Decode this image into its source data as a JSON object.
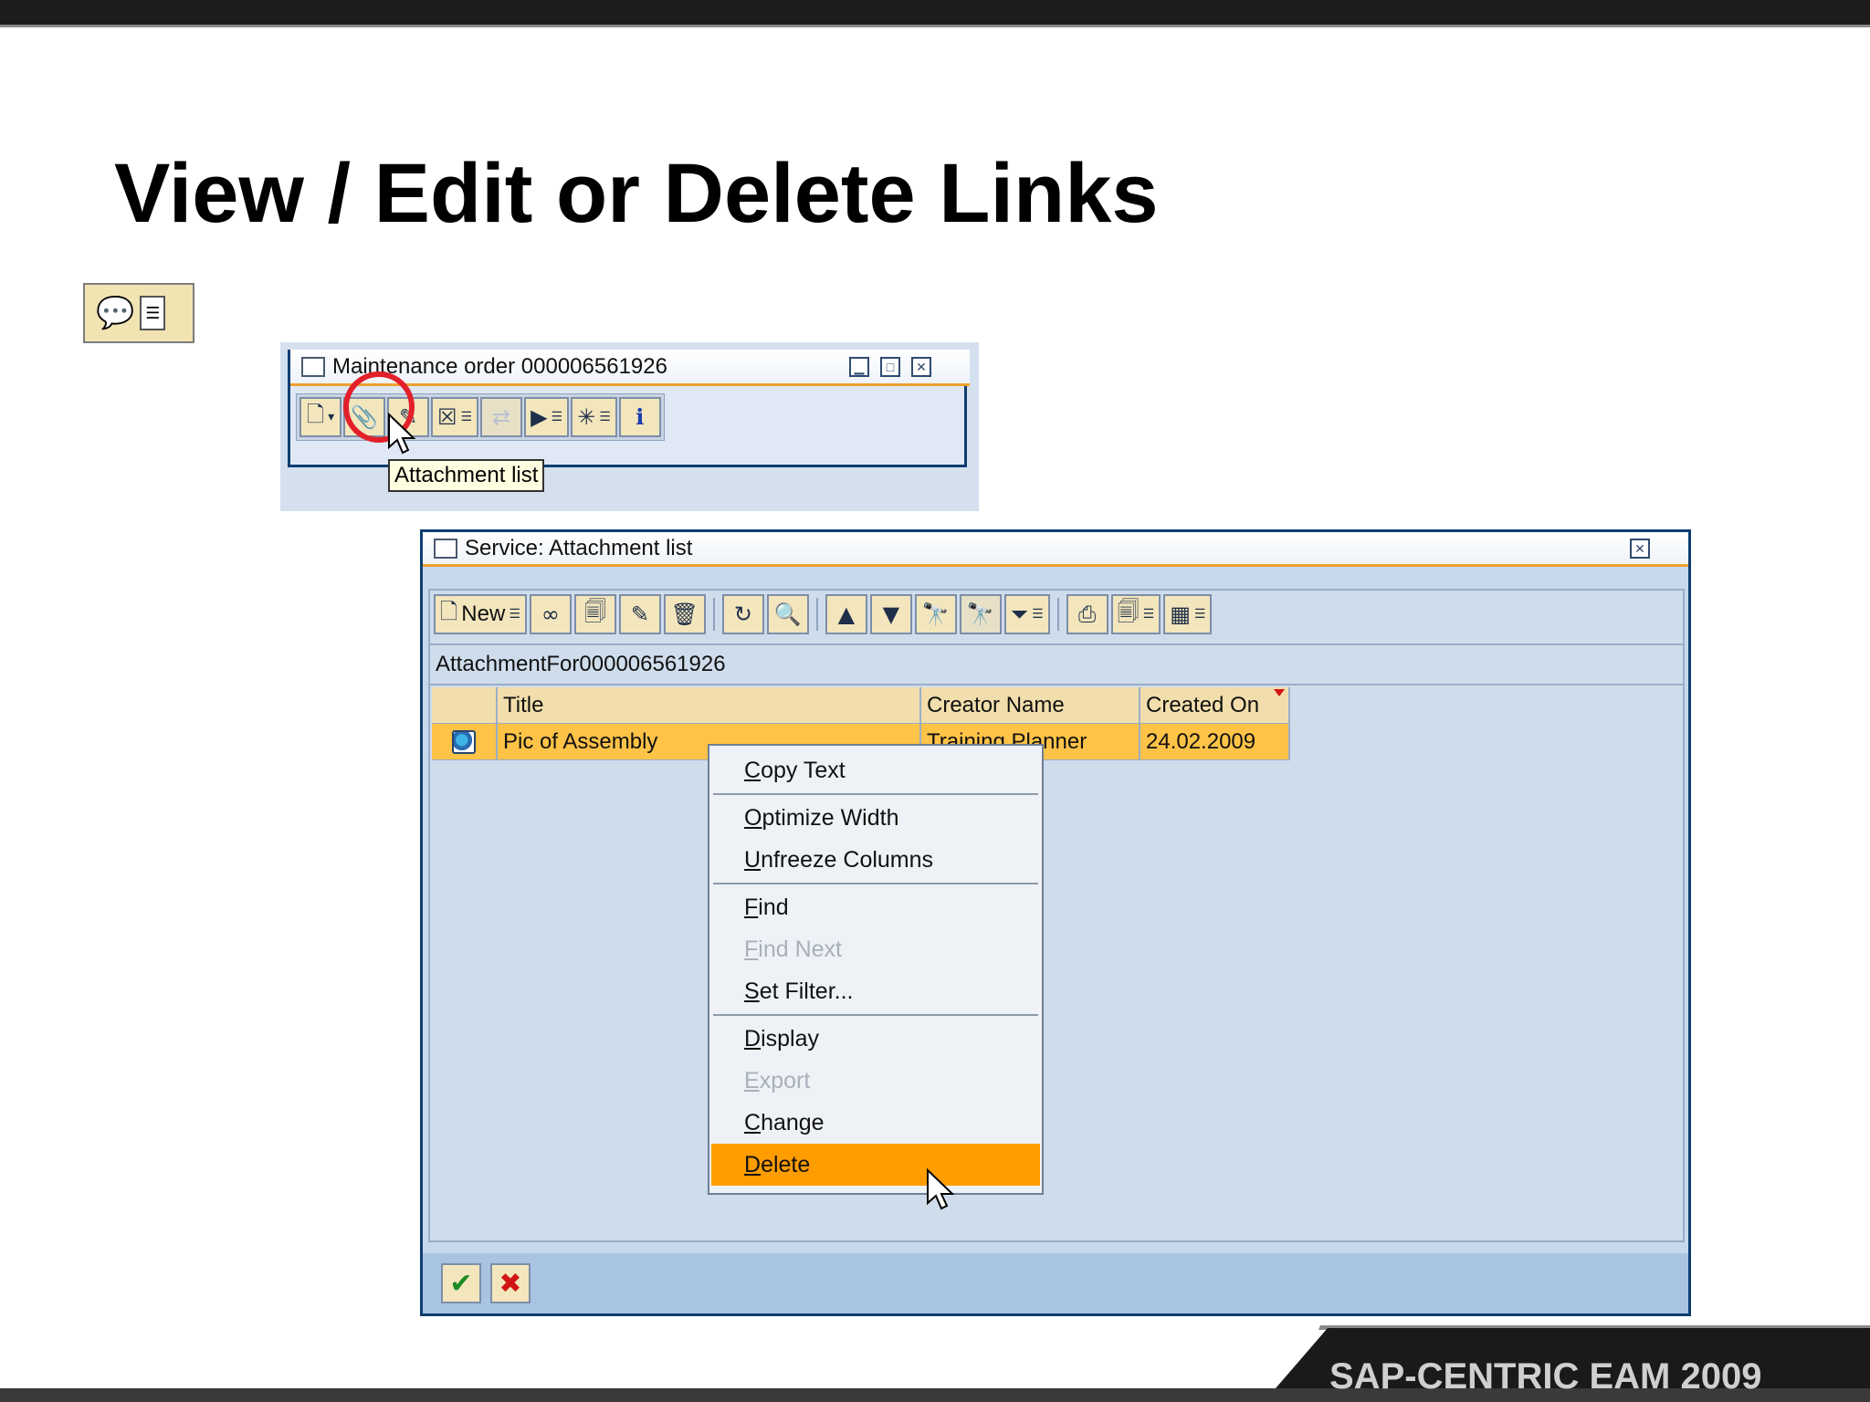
{
  "slide": {
    "title": "View / Edit or Delete Links",
    "brand": "SAP-CENTRIC EAM 2009"
  },
  "mini_window": {
    "title": "Maintenance order 000006561926",
    "tooltip": "Attachment list",
    "toolbar_icons": [
      "create-icon",
      "attachment-list-icon",
      "edit-pencil-icon",
      "export-icon",
      "relationship-icon",
      "send-icon",
      "workflow-icon",
      "info-icon"
    ]
  },
  "dialog": {
    "title": "Service: Attachment list",
    "toolbar": {
      "new_label": "New"
    },
    "caption": "AttachmentFor000006561926",
    "columns": [
      "Title",
      "Creator Name",
      "Created On"
    ],
    "rows": [
      {
        "title": "Pic of Assembly",
        "creator": "Training Planner",
        "created_on": "24.02.2009"
      }
    ]
  },
  "context_menu": {
    "items": [
      {
        "label": "Copy Text",
        "accel": "C",
        "rest": "opy Text",
        "enabled": true
      },
      {
        "label": "Optimize Width",
        "accel": "O",
        "rest": "ptimize Width",
        "enabled": true
      },
      {
        "label": "Unfreeze Columns",
        "accel": "U",
        "rest": "nfreeze Columns",
        "enabled": true
      },
      {
        "label": "Find",
        "accel": "F",
        "rest": "ind",
        "enabled": true
      },
      {
        "label": "Find Next",
        "accel": "F",
        "rest": "ind Next",
        "enabled": false
      },
      {
        "label": "Set Filter...",
        "accel": "S",
        "rest": "et Filter...",
        "enabled": true
      },
      {
        "label": "Display",
        "accel": "D",
        "rest": "isplay",
        "enabled": true
      },
      {
        "label": "Export",
        "accel": "E",
        "rest": "xport",
        "enabled": false
      },
      {
        "label": "Change",
        "accel": "C",
        "rest": "hange",
        "enabled": true
      },
      {
        "label": "Delete",
        "accel": "D",
        "rest": "elete",
        "enabled": true,
        "highlighted": true
      }
    ]
  }
}
